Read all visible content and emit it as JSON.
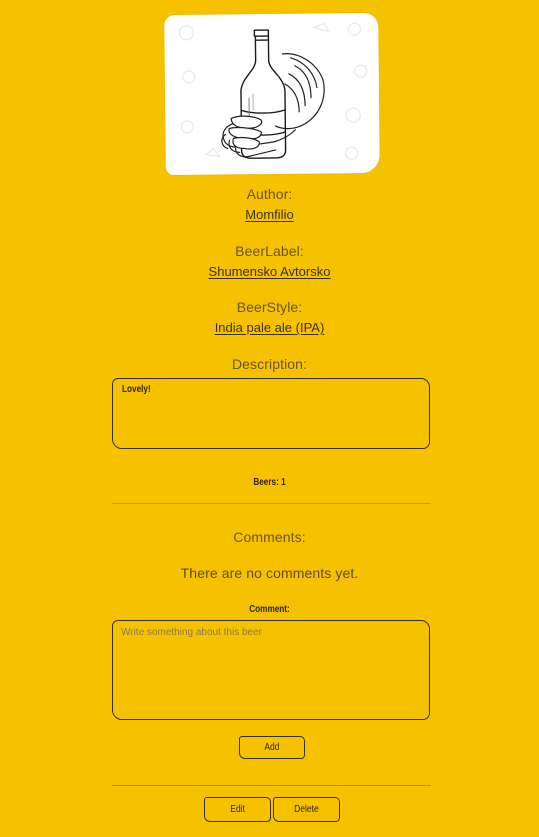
{
  "hero": {
    "image_icon": "beer-bottle-in-hand-illustration"
  },
  "details": {
    "author_label": "Author:",
    "author_value": "Momfilio",
    "beer_label_label": "BeerLabel:",
    "beer_label_value": "Shumensko Avtorsko",
    "beer_style_label": "BeerStyle:",
    "beer_style_value": "India pale ale (IPA)",
    "description_label": "Description:",
    "description_value": "Lovely!"
  },
  "beers_count": "Beers: 1",
  "comments": {
    "heading": "Comments:",
    "empty_text": "There are no comments yet.",
    "comment_label": "Comment:",
    "placeholder": "Write something about this beer",
    "add_label": "Add"
  },
  "actions": {
    "edit_label": "Edit",
    "delete_label": "Delete"
  },
  "colors": {
    "background": "#f6c200",
    "text": "#5a4a1a",
    "link": "#3d3010"
  }
}
